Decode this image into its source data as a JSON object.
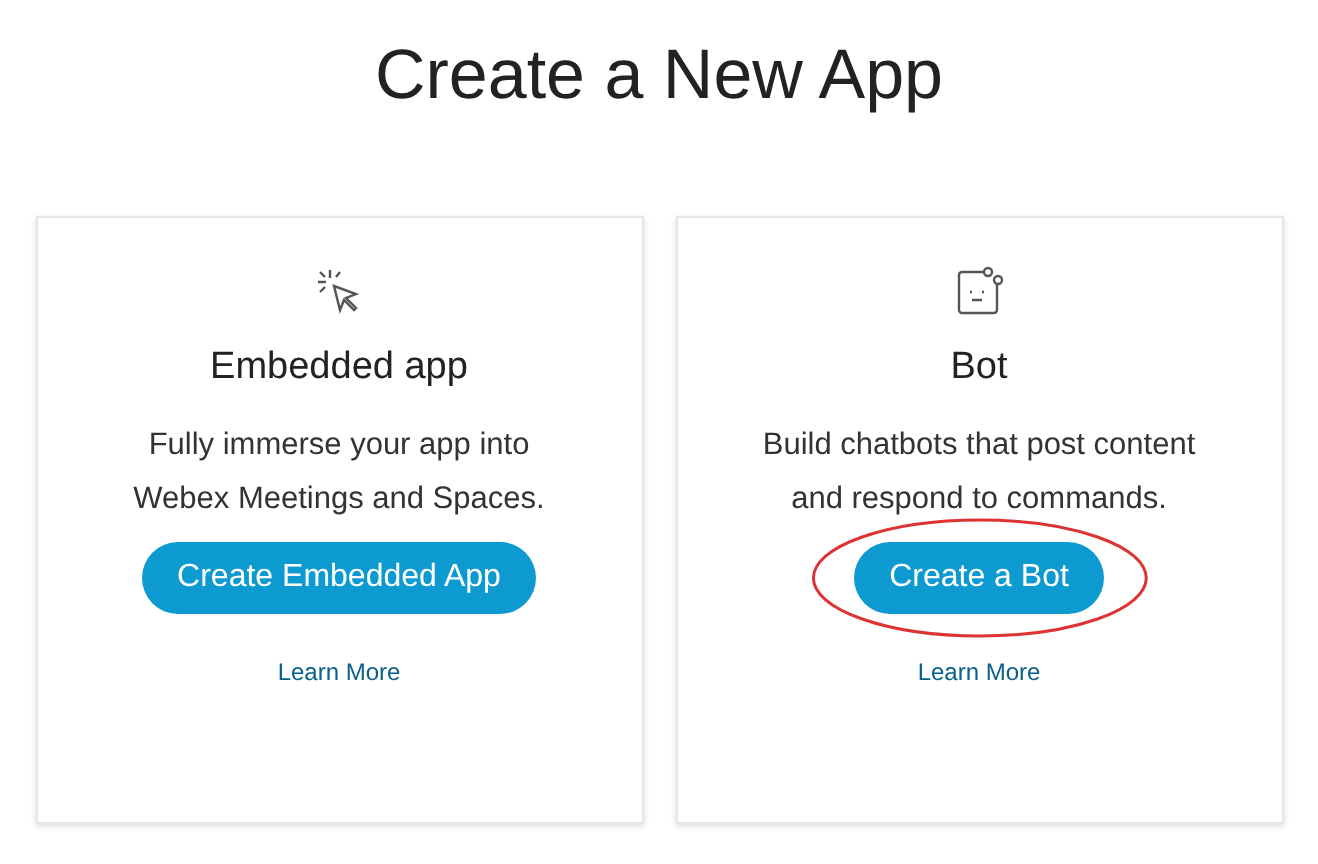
{
  "title": "Create a New App",
  "cards": [
    {
      "kind": "embedded",
      "name": "Embedded app",
      "description": "Fully immerse your app into Webex Meetings and Spaces.",
      "button": "Create Embedded App",
      "link": "Learn More",
      "highlighted": false
    },
    {
      "kind": "bot",
      "name": "Bot",
      "description": "Build chatbots that post content and respond to commands.",
      "button": "Create a Bot",
      "link": "Learn More",
      "highlighted": true
    }
  ]
}
